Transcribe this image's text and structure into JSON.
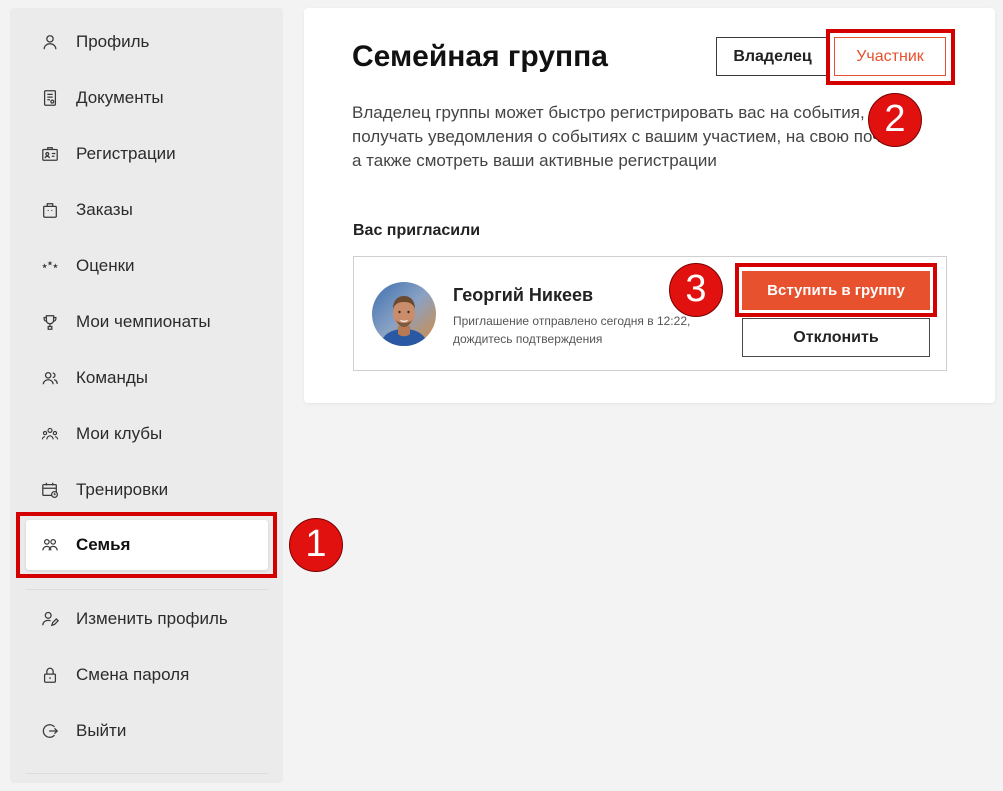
{
  "sidebar": {
    "items": [
      {
        "label": "Профиль",
        "icon": "user-icon"
      },
      {
        "label": "Документы",
        "icon": "document-icon"
      },
      {
        "label": "Регистрации",
        "icon": "id-card-icon"
      },
      {
        "label": "Заказы",
        "icon": "bag-icon"
      },
      {
        "label": "Оценки",
        "icon": "stars-icon"
      },
      {
        "label": "Мои чемпионаты",
        "icon": "trophy-icon"
      },
      {
        "label": "Команды",
        "icon": "team-icon"
      },
      {
        "label": "Мои клубы",
        "icon": "clubs-icon"
      },
      {
        "label": "Тренировки",
        "icon": "calendar-clock-icon"
      },
      {
        "label": "Семья",
        "icon": "family-icon",
        "active": true
      }
    ],
    "account_items": [
      {
        "label": "Изменить профиль",
        "icon": "edit-profile-icon"
      },
      {
        "label": "Смена пароля",
        "icon": "lock-icon"
      },
      {
        "label": "Выйти",
        "icon": "logout-icon"
      }
    ]
  },
  "main": {
    "title": "Семейная группа",
    "tabs": [
      {
        "label": "Владелец",
        "active": false
      },
      {
        "label": "Участник",
        "active": true
      }
    ],
    "description_lines": [
      "Владелец группы может быстро регистрировать вас на события,",
      "получать уведомления о событиях с вашим участием, на свою почту,",
      "а также смотреть ваши активные регистрации"
    ],
    "invited_heading": "Вас пригласили",
    "invite": {
      "name": "Георгий Никеев",
      "message_lines": [
        "Приглашение отправлено сегодня в 12:22,",
        "дождитесь подтверждения"
      ],
      "join_label": "Вступить в группу",
      "decline_label": "Отклонить"
    }
  },
  "annotations": [
    {
      "number": "1"
    },
    {
      "number": "2"
    },
    {
      "number": "3"
    }
  ],
  "colors": {
    "accent": "#e8512d",
    "annotation": "#d40000",
    "sidebar_bg": "#ebebeb",
    "page_bg": "#f3f3f3"
  }
}
